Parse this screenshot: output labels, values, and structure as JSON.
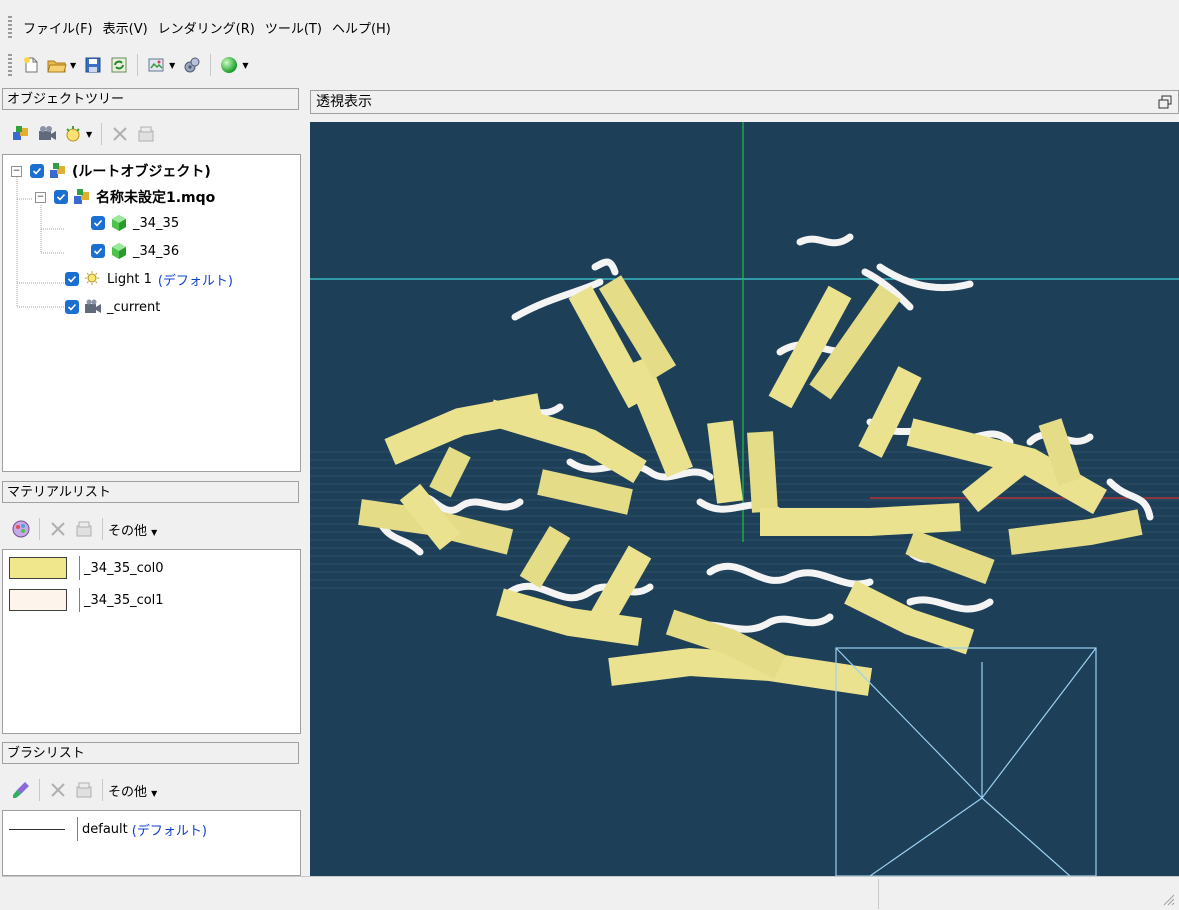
{
  "menu": [
    "ファイル(F)",
    "表示(V)",
    "レンダリング(R)",
    "ツール(T)",
    "ヘルプ(H)"
  ],
  "toolbar_icons": [
    "new-file-icon",
    "open-folder-icon",
    "save-icon",
    "refresh-icon",
    "import-icon",
    "plugin-icon",
    "render-sphere-icon"
  ],
  "object_tree": {
    "title": "オブジェクトツリー",
    "items": [
      {
        "label": "(ルートオブジェクト)",
        "default": ""
      },
      {
        "label": "名称未設定1.mqo",
        "default": ""
      },
      {
        "label": "_34_35",
        "default": ""
      },
      {
        "label": "_34_36",
        "default": ""
      },
      {
        "label": "Light 1",
        "default": "(デフォルト)"
      },
      {
        "label": "_current",
        "default": ""
      }
    ]
  },
  "material_list": {
    "title": "マテリアルリスト",
    "other_label": "その他",
    "items": [
      {
        "name": "_34_35_col0",
        "color": "#f0e68c"
      },
      {
        "name": "_34_35_col1",
        "color": "#fdf5ec"
      }
    ]
  },
  "brush_list": {
    "title": "ブラシリスト",
    "other_label": "その他",
    "items": [
      {
        "name": "default",
        "default": "(デフォルト)"
      }
    ]
  },
  "viewport": {
    "title": "透視表示",
    "background": "#1e3f58",
    "model_colors": {
      "helix": "#eae28e",
      "coil": "#ffffff"
    }
  }
}
